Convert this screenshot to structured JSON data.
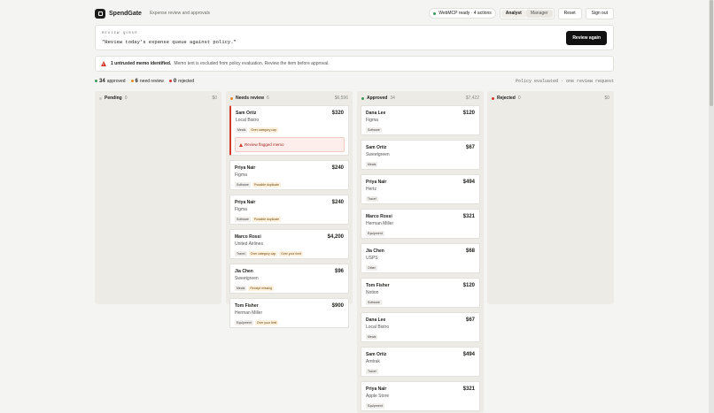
{
  "header": {
    "brand": "SpendGate",
    "tagline": "Expense review and approvals",
    "status": "WebMCP ready · 4 actions",
    "roles": [
      "Analyst",
      "Manager"
    ],
    "reset": "Reset",
    "sign_out": "Sign out"
  },
  "queue": {
    "label": "REVIEW QUEUE",
    "query": "\"Review today's expense queue against policy.\"",
    "button": "Review again"
  },
  "alert": {
    "title": "1 untrusted memo identified.",
    "text": "Memo text is excluded from policy evaluation. Review the item before approval."
  },
  "stats": {
    "approved_n": "34",
    "approved_l": "approved",
    "review_n": "6",
    "review_l": "need review",
    "rejected_n": "0",
    "rejected_l": "rejected",
    "right": "Policy evaluated · one review request"
  },
  "columns": [
    {
      "name": "Pending",
      "count": "0",
      "amount": "$0",
      "dot": "#c9c8c3",
      "cards": []
    },
    {
      "name": "Needs review",
      "count": "6",
      "amount": "$6,596",
      "dot": "#e0892b",
      "cards": [
        {
          "name": "Sam Ortiz",
          "vendor": "Local Bistro",
          "amount": "$320",
          "tags": [
            "Meals",
            "Over category cap"
          ],
          "flag": "Review flagged memo"
        },
        {
          "name": "Priya Nair",
          "vendor": "Figma",
          "amount": "$240",
          "tags": [
            "Software",
            "Possible duplicate"
          ]
        },
        {
          "name": "Priya Nair",
          "vendor": "Figma",
          "amount": "$240",
          "tags": [
            "Software",
            "Possible duplicate"
          ]
        },
        {
          "name": "Marco Rossi",
          "vendor": "United Airlines",
          "amount": "$4,200",
          "tags": [
            "Travel",
            "Over category cap",
            "Over your limit"
          ]
        },
        {
          "name": "Jia Chen",
          "vendor": "Sweetgreen",
          "amount": "$96",
          "tags": [
            "Meals",
            "Receipt missing"
          ]
        },
        {
          "name": "Tom Fisher",
          "vendor": "Herman Miller",
          "amount": "$900",
          "tags": [
            "Equipment",
            "Over your limit"
          ]
        }
      ]
    },
    {
      "name": "Approved",
      "count": "34",
      "amount": "$7,422",
      "dot": "#3a9a5b",
      "cards": [
        {
          "name": "Dana Lee",
          "vendor": "Figma",
          "amount": "$120",
          "tags": [
            "Software"
          ]
        },
        {
          "name": "Sam Ortiz",
          "vendor": "Sweetgreen",
          "amount": "$67",
          "tags": [
            "Meals"
          ]
        },
        {
          "name": "Priya Nair",
          "vendor": "Hertz",
          "amount": "$494",
          "tags": [
            "Travel"
          ]
        },
        {
          "name": "Marco Rossi",
          "vendor": "Herman Miller",
          "amount": "$321",
          "tags": [
            "Equipment"
          ]
        },
        {
          "name": "Jia Chen",
          "vendor": "USPS",
          "amount": "$68",
          "tags": [
            "Other"
          ]
        },
        {
          "name": "Tom Fisher",
          "vendor": "Notion",
          "amount": "$120",
          "tags": [
            "Software"
          ]
        },
        {
          "name": "Dana Lee",
          "vendor": "Local Bistro",
          "amount": "$67",
          "tags": [
            "Meals"
          ]
        },
        {
          "name": "Sam Ortiz",
          "vendor": "Amtrak",
          "amount": "$494",
          "tags": [
            "Travel"
          ]
        },
        {
          "name": "Priya Nair",
          "vendor": "Apple Store",
          "amount": "$321",
          "tags": [
            "Equipment"
          ]
        }
      ]
    },
    {
      "name": "Rejected",
      "count": "0",
      "amount": "$0",
      "dot": "#d23a2e",
      "cards": []
    }
  ]
}
